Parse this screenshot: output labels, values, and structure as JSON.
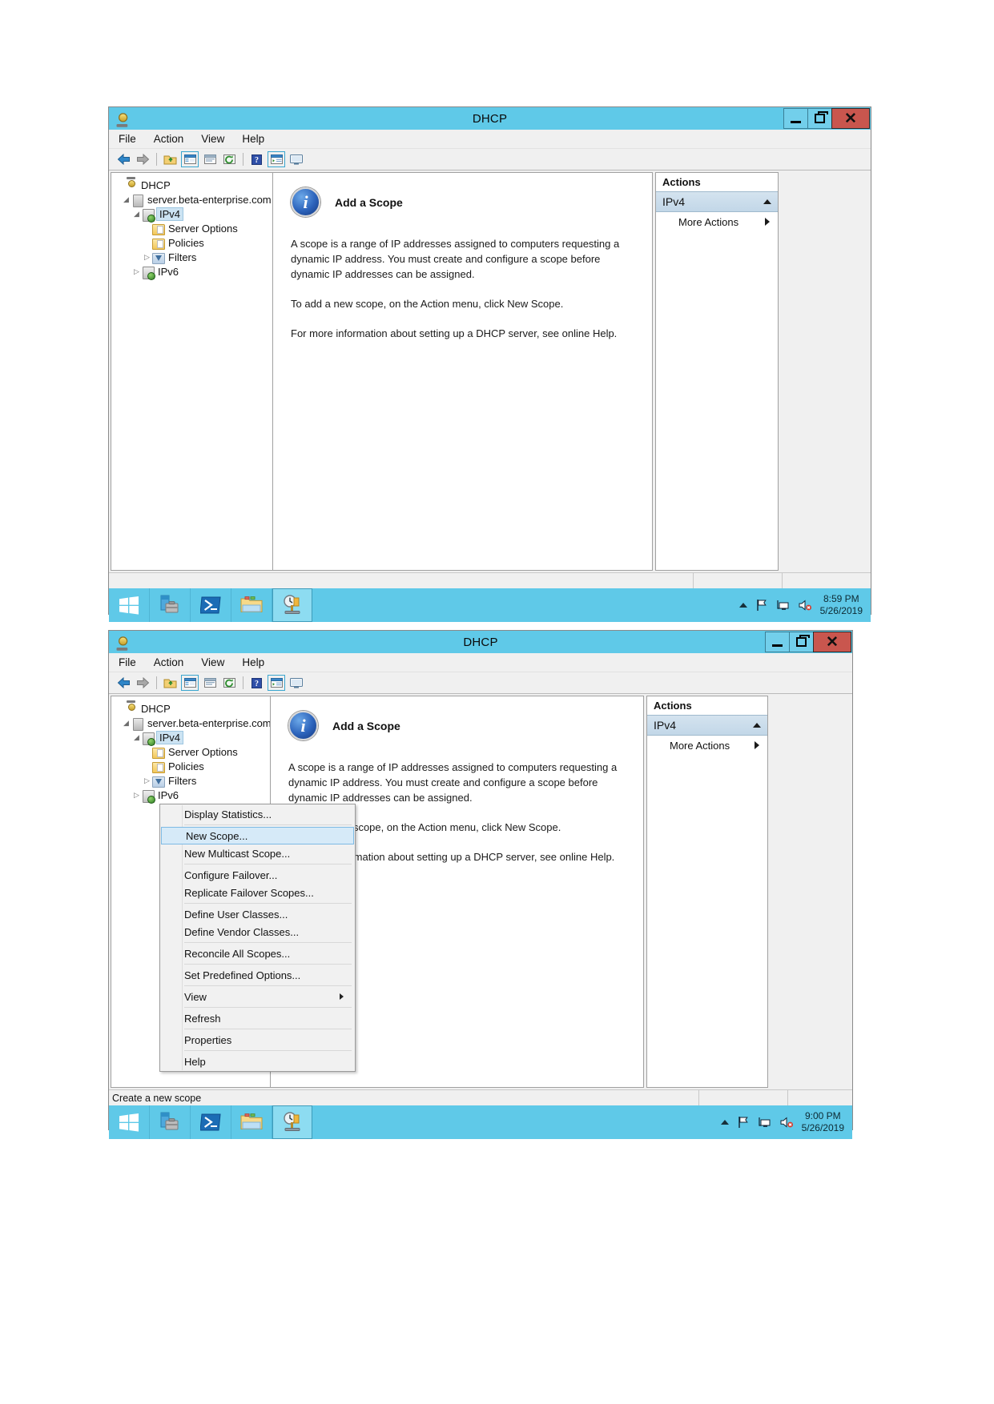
{
  "app": {
    "title": "DHCP",
    "window_icon": "dhcp-icon"
  },
  "menubar": {
    "items": [
      "File",
      "Action",
      "View",
      "Help"
    ]
  },
  "toolbar": {
    "items": [
      {
        "name": "back-icon"
      },
      {
        "name": "forward-icon"
      },
      {
        "name": "separator"
      },
      {
        "name": "up-one-level-icon"
      },
      {
        "name": "show-hide-console-tree-icon"
      },
      {
        "name": "properties-icon"
      },
      {
        "name": "refresh-icon"
      },
      {
        "name": "separator"
      },
      {
        "name": "help-icon"
      },
      {
        "name": "export-list-icon"
      },
      {
        "name": "show-hide-action-pane-icon"
      }
    ]
  },
  "tree": {
    "nodes": [
      {
        "label": "DHCP",
        "indent": 0,
        "expander": "",
        "icon": "dhcp-root-icon",
        "selected": false
      },
      {
        "label": "server.beta-enterprise.com",
        "indent": 1,
        "expander": "expanded",
        "icon": "server-icon",
        "selected": false
      },
      {
        "label": "IPv4",
        "indent": 2,
        "expander": "expanded",
        "icon": "ipv4-icon",
        "selected": true
      },
      {
        "label": "Server Options",
        "indent": 3,
        "expander": "",
        "icon": "folder-options-icon",
        "selected": false
      },
      {
        "label": "Policies",
        "indent": 3,
        "expander": "",
        "icon": "folder-policies-icon",
        "selected": false
      },
      {
        "label": "Filters",
        "indent": 3,
        "expander": "collapsed",
        "icon": "filter-icon",
        "selected": false
      },
      {
        "label": "IPv6",
        "indent": 2,
        "expander": "collapsed",
        "icon": "ipv6-icon",
        "selected": false
      }
    ]
  },
  "main": {
    "heading": "Add a Scope",
    "heading_icon": "info-icon",
    "paragraphs": [
      "A scope is a range of IP addresses assigned to computers requesting a dynamic IP address. You must create and configure a scope before dynamic IP addresses can be assigned.",
      "To add a new scope, on the Action menu, click New Scope.",
      "For more information about setting up a DHCP server, see online Help."
    ]
  },
  "actions_pane": {
    "header": "Actions",
    "section": "IPv4",
    "section_collapse_icon": "caret-up-icon",
    "items": [
      {
        "label": "More Actions",
        "submenu_icon": "caret-right-icon"
      }
    ]
  },
  "context_menu": {
    "items": [
      {
        "label": "Display Statistics...",
        "highlighted": false,
        "separator_after": true
      },
      {
        "label": "New Scope...",
        "highlighted": true,
        "separator_after": false
      },
      {
        "label": "New Multicast Scope...",
        "highlighted": false,
        "separator_after": true
      },
      {
        "label": "Configure Failover...",
        "highlighted": false,
        "separator_after": false
      },
      {
        "label": "Replicate Failover Scopes...",
        "highlighted": false,
        "separator_after": true
      },
      {
        "label": "Define User Classes...",
        "highlighted": false,
        "separator_after": false
      },
      {
        "label": "Define Vendor Classes...",
        "highlighted": false,
        "separator_after": true
      },
      {
        "label": "Reconcile All Scopes...",
        "highlighted": false,
        "separator_after": true
      },
      {
        "label": "Set Predefined Options...",
        "highlighted": false,
        "separator_after": true
      },
      {
        "label": "View",
        "highlighted": false,
        "submenu": true,
        "separator_after": true
      },
      {
        "label": "Refresh",
        "highlighted": false,
        "separator_after": true
      },
      {
        "label": "Properties",
        "highlighted": false,
        "separator_after": true
      },
      {
        "label": "Help",
        "highlighted": false,
        "separator_after": false
      }
    ]
  },
  "status_bar": {
    "text": "Create a new scope"
  },
  "taskbar_top": {
    "buttons": [
      {
        "name": "start-button",
        "icon": "windows-logo-icon",
        "active": false
      },
      {
        "name": "server-manager-button",
        "icon": "server-manager-icon",
        "active": false
      },
      {
        "name": "powershell-button",
        "icon": "powershell-icon",
        "active": false
      },
      {
        "name": "file-explorer-button",
        "icon": "file-explorer-icon",
        "active": false
      },
      {
        "name": "dhcp-button",
        "icon": "dhcp-taskbar-icon",
        "active": true
      }
    ],
    "tray": {
      "overflow_icon": "show-hidden-icons-icon",
      "icons": [
        "action-center-flag-icon",
        "network-icon",
        "volume-muted-icon"
      ],
      "time": "8:59 PM",
      "date": "5/26/2019"
    }
  },
  "taskbar_bottom": {
    "buttons": [
      {
        "name": "start-button",
        "icon": "windows-logo-icon",
        "active": false
      },
      {
        "name": "server-manager-button",
        "icon": "server-manager-icon",
        "active": false
      },
      {
        "name": "powershell-button",
        "icon": "powershell-icon",
        "active": false
      },
      {
        "name": "file-explorer-button",
        "icon": "file-explorer-icon",
        "active": false
      },
      {
        "name": "dhcp-button",
        "icon": "dhcp-taskbar-icon",
        "active": true
      }
    ],
    "tray": {
      "overflow_icon": "show-hidden-icons-icon",
      "icons": [
        "action-center-flag-icon",
        "network-icon",
        "volume-muted-icon"
      ],
      "time": "9:00 PM",
      "date": "5/26/2019"
    }
  },
  "window_controls": {
    "minimize": "minimize-button",
    "restore": "restore-button",
    "close": "close-button"
  },
  "colors": {
    "titlebar": "#5fc9e8",
    "close": "#c9564e",
    "selection": "#cce3f2",
    "taskbar": "#5fc9e8"
  }
}
